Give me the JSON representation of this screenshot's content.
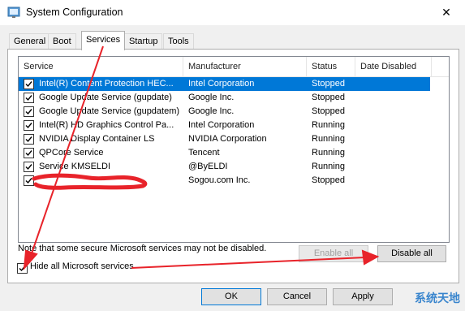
{
  "window": {
    "title": "System Configuration",
    "close_glyph": "✕"
  },
  "tabs": [
    {
      "label": "General",
      "active": false
    },
    {
      "label": "Boot",
      "active": false
    },
    {
      "label": "Services",
      "active": true
    },
    {
      "label": "Startup",
      "active": false
    },
    {
      "label": "Tools",
      "active": false
    }
  ],
  "table": {
    "columns": [
      "Service",
      "Manufacturer",
      "Status",
      "Date Disabled"
    ],
    "rows": [
      {
        "service": "Intel(R) Content Protection HEC...",
        "manufacturer": "Intel Corporation",
        "status": "Stopped",
        "date_disabled": "",
        "checked": true,
        "selected": true
      },
      {
        "service": "Google Update Service (gupdate)",
        "manufacturer": "Google Inc.",
        "status": "Stopped",
        "date_disabled": "",
        "checked": true,
        "selected": false
      },
      {
        "service": "Google Update Service (gupdatem)",
        "manufacturer": "Google Inc.",
        "status": "Stopped",
        "date_disabled": "",
        "checked": true,
        "selected": false
      },
      {
        "service": "Intel(R) HD Graphics Control Pa...",
        "manufacturer": "Intel Corporation",
        "status": "Running",
        "date_disabled": "",
        "checked": true,
        "selected": false
      },
      {
        "service": "NVIDIA Display Container LS",
        "manufacturer": "NVIDIA Corporation",
        "status": "Running",
        "date_disabled": "",
        "checked": true,
        "selected": false
      },
      {
        "service": "QPCore Service",
        "manufacturer": "Tencent",
        "status": "Running",
        "date_disabled": "",
        "checked": true,
        "selected": false
      },
      {
        "service": "Service KMSELDI",
        "manufacturer": "@ByELDI",
        "status": "Running",
        "date_disabled": "",
        "checked": true,
        "selected": false
      },
      {
        "service": "",
        "manufacturer": "Sogou.com Inc.",
        "status": "Stopped",
        "date_disabled": "",
        "checked": true,
        "selected": false
      }
    ]
  },
  "note": "Note that some secure Microsoft services may not be disabled.",
  "buttons": {
    "enable_all": "Enable all",
    "disable_all": "Disable all",
    "ok": "OK",
    "cancel": "Cancel",
    "apply": "Apply"
  },
  "hide_ms": {
    "label": "Hide all Microsoft services",
    "checked": true
  },
  "watermark": "系统天地",
  "colors": {
    "selection": "#0078d7",
    "annotation": "#e8232a",
    "dialog_bg": "#f0f0f0"
  },
  "icons": {
    "app": "msconfig-icon",
    "close": "close-icon",
    "check": "check-icon"
  }
}
